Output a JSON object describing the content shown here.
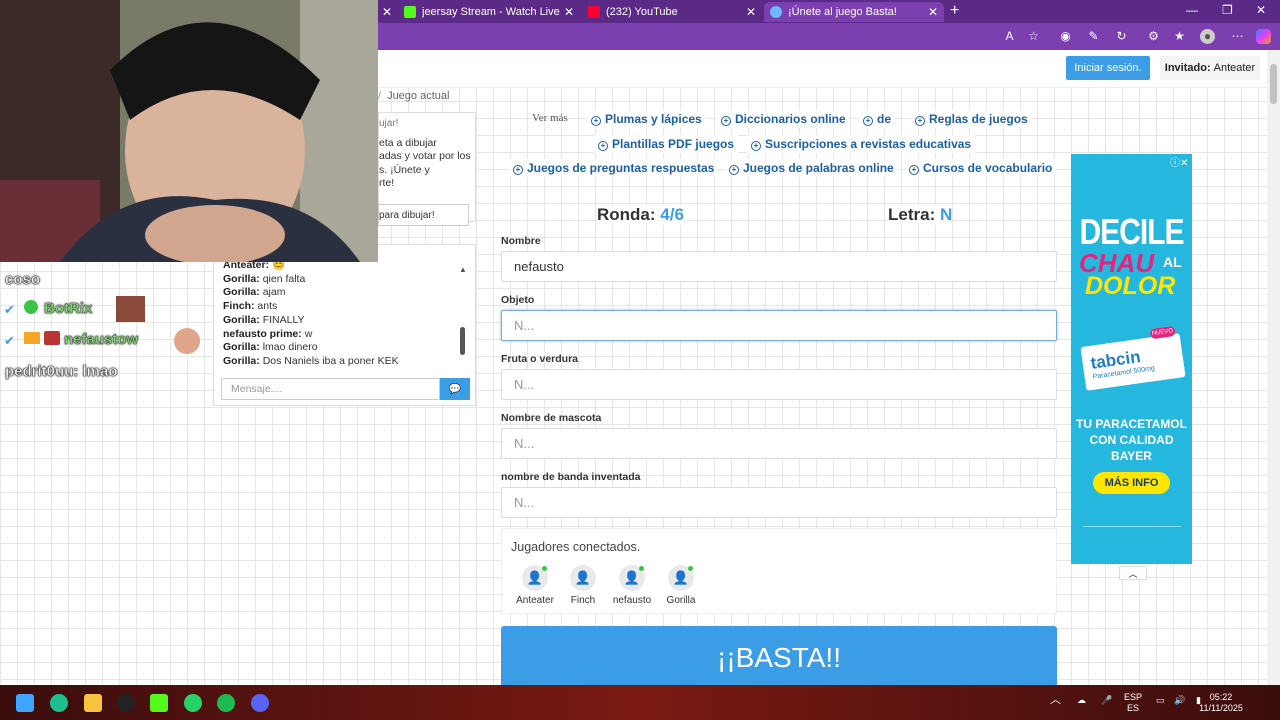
{
  "browser": {
    "tabs": [
      {
        "label": "jeersay Stream - Watch Live on Ki",
        "icon_color": "#53fc18"
      },
      {
        "label": "(232) YouTube",
        "icon_color": "#ff0033"
      },
      {
        "label": "¡Únete al juego Basta!",
        "icon_color": "#6fb7ff"
      }
    ]
  },
  "header": {
    "login_label": "Iniciar sesión.",
    "guest_prefix": "Invitado:",
    "guest_name": "Anteater"
  },
  "sidebar": {
    "breadcrumb": "Juego actual",
    "info_title": "ujar!",
    "info_text": [
      "eta a dibujar",
      "adas y votar por los",
      "s. ¡Únete y",
      "rte!"
    ],
    "draw_button": "para dibujar!"
  },
  "chat": {
    "messages": [
      {
        "user": "Anteater:",
        "text": "😊"
      },
      {
        "user": "Gorilla:",
        "text": "qien falta"
      },
      {
        "user": "Gorilla:",
        "text": "ajam"
      },
      {
        "user": "Finch:",
        "text": "ants"
      },
      {
        "user": "Gorilla:",
        "text": "FINALLY"
      },
      {
        "user": "nefausto prime:",
        "text": "w"
      },
      {
        "user": "Gorilla:",
        "text": "lmao dinero"
      },
      {
        "user": "Gorilla:",
        "text": "Dos Naniels iba a poner KEK"
      }
    ],
    "input_placeholder": "Mensaje...."
  },
  "stream_overlay": {
    "lines": [
      "coso",
      "BotRix",
      "nefaustow",
      "pedrit0uu: lmao"
    ]
  },
  "suggestions": {
    "label": "Ver más",
    "chips": [
      "Plumas y lápices",
      "Diccionarios online",
      "de",
      "Reglas de juegos",
      "Plantillas PDF juegos",
      "Suscripciones a revistas educativas",
      "Juegos de preguntas respuestas",
      "Juegos de palabras online",
      "Cursos de vocabulario"
    ]
  },
  "game": {
    "round_label": "Ronda:",
    "round_value": "4/6",
    "letter_label": "Letra:",
    "letter_value": "N",
    "fields": [
      {
        "label": "Nombre",
        "value": "nefausto",
        "placeholder": ""
      },
      {
        "label": "Objeto",
        "value": "",
        "placeholder": "N..."
      },
      {
        "label": "Fruta o verdura",
        "value": "",
        "placeholder": "N..."
      },
      {
        "label": "Nombre de mascota",
        "value": "",
        "placeholder": "N..."
      },
      {
        "label": "nombre de banda inventada",
        "value": "",
        "placeholder": "N..."
      }
    ],
    "players_title": "Jugadores conectados.",
    "players": [
      "Anteater",
      "Finch",
      "nefausto",
      "Gorilla"
    ],
    "basta_label": "¡¡BASTA!!"
  },
  "ad": {
    "line1": "DECILE",
    "line2": "CHAU",
    "line3": "AL",
    "line4": "DOLOR",
    "product": "tabcin",
    "product_sub": "Paracetamol 500mg",
    "badge": "NUEVO",
    "tagline1": "TU PARACETAMOL",
    "tagline2": "CON CALIDAD BAYER",
    "cta": "MÁS INFO"
  },
  "taskbar": {
    "lang1": "ESP",
    "lang2": "ES",
    "time": "05:22",
    "date": "11/11/2025"
  },
  "colors": {
    "accent": "#3b9de6",
    "browser": "#5b2a86",
    "online": "#3ec34a"
  }
}
